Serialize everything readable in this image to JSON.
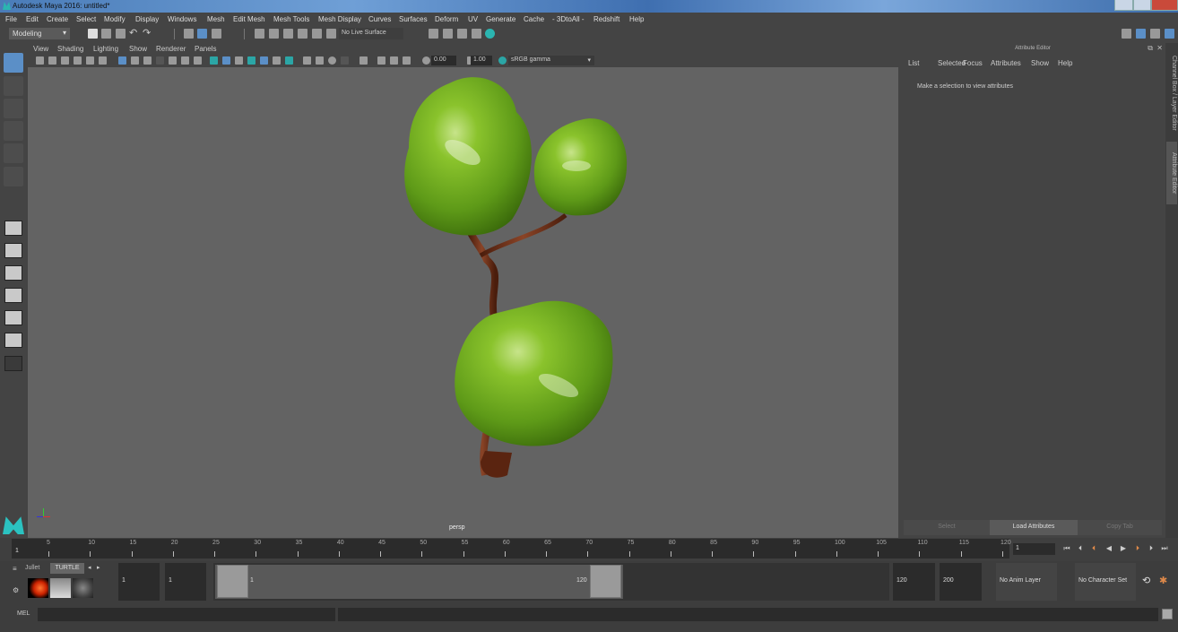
{
  "window": {
    "title": "Autodesk Maya 2016: untitled*"
  },
  "menubar": [
    "File",
    "Edit",
    "Create",
    "Select",
    "Modify",
    "Display",
    "Windows",
    "Mesh",
    "Edit Mesh",
    "Mesh Tools",
    "Mesh Display",
    "Curves",
    "Surfaces",
    "Deform",
    "UV",
    "Generate",
    "Cache",
    "- 3DtoAll -",
    "Redshift",
    "Help"
  ],
  "toolbar": {
    "workspace": "Modeling",
    "live_surface": "No Live Surface"
  },
  "panel": {
    "menu": [
      "View",
      "Shading",
      "Lighting",
      "Show",
      "Renderer",
      "Panels"
    ],
    "exposure": "0.00",
    "gamma": "1.00",
    "color_space": "sRGB gamma",
    "camera_label": "persp"
  },
  "attribute_editor": {
    "title": "Attribute Editor",
    "menu": [
      "List",
      "Selected",
      "Focus",
      "Attributes",
      "Show",
      "Help"
    ],
    "message": "Make a selection to view attributes",
    "buttons": {
      "select": "Select",
      "load": "Load Attributes",
      "copy": "Copy Tab"
    }
  },
  "side_tabs": {
    "channel_box": "Channel Box / Layer Editor",
    "attribute_editor": "Attribute Editor"
  },
  "timeline": {
    "ticks": [
      "5",
      "10",
      "15",
      "20",
      "25",
      "30",
      "35",
      "40",
      "45",
      "50",
      "55",
      "60",
      "65",
      "70",
      "75",
      "80",
      "85",
      "90",
      "95",
      "100",
      "105",
      "110",
      "115",
      "120"
    ],
    "start_marker": "1",
    "current_frame": "1"
  },
  "range": {
    "start": "1",
    "playback_start": "1",
    "slider_start": "1",
    "slider_end": "120",
    "playback_end": "120",
    "end": "200",
    "anim_layer": "No Anim Layer",
    "character_set": "No Character Set"
  },
  "shelf": {
    "tab_partial": "Jullet",
    "tab_active": "TURTLE"
  },
  "command_line": {
    "label": "MEL"
  },
  "colors": {
    "accent_blue": "#5b8fc7",
    "viewport_bg": "#636363",
    "foliage": "#7fb82a",
    "trunk": "#6b2e16"
  }
}
